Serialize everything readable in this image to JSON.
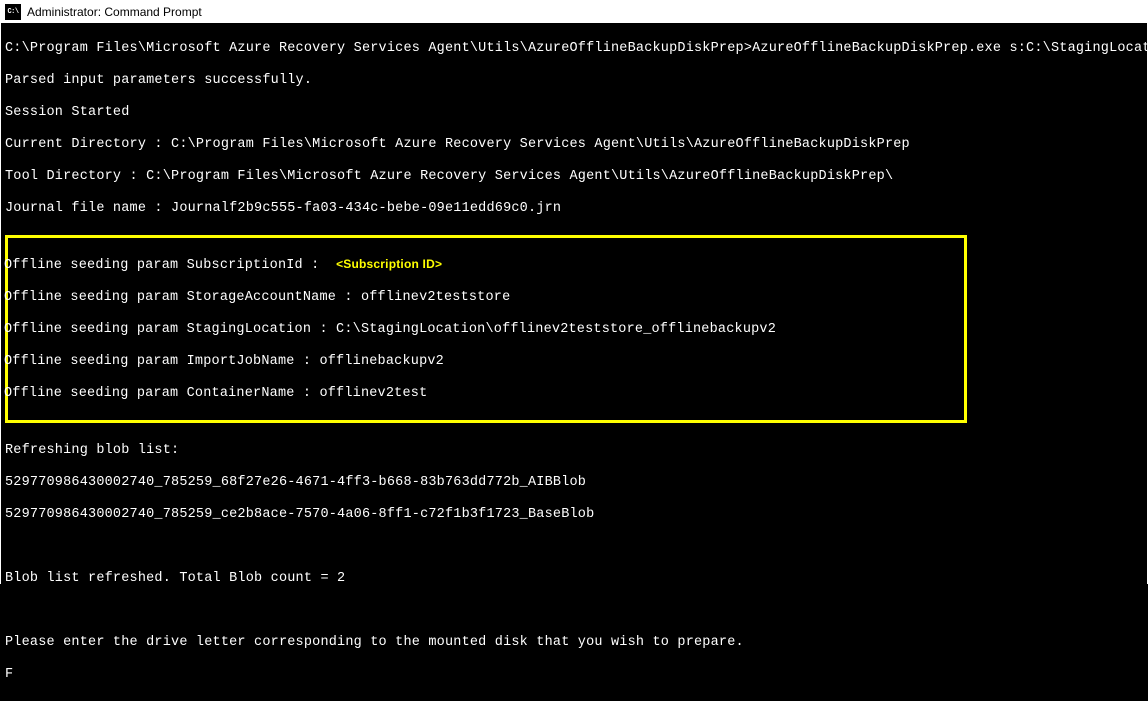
{
  "window": {
    "title": "Administrator: Command Prompt"
  },
  "terminal": {
    "command_line": "C:\\Program Files\\Microsoft Azure Recovery Services Agent\\Utils\\AzureOfflineBackupDiskPrep>AzureOfflineBackupDiskPrep.exe s:C:\\StagingLocation",
    "parsed_params": "Parsed input parameters successfully.",
    "session_started": "Session Started",
    "current_dir": "Current Directory : C:\\Program Files\\Microsoft Azure Recovery Services Agent\\Utils\\AzureOfflineBackupDiskPrep",
    "tool_dir": "Tool Directory : C:\\Program Files\\Microsoft Azure Recovery Services Agent\\Utils\\AzureOfflineBackupDiskPrep\\",
    "journal": "Journal file name : Journalf2b9c555-fa03-434c-bebe-09e11edd69c0.jrn",
    "offline_params": {
      "subscription_prefix": "Offline seeding param SubscriptionId : ",
      "subscription_value": "<Subscription ID>",
      "storage_account": "Offline seeding param StorageAccountName : offlinev2teststore",
      "staging_location": "Offline seeding param StagingLocation : C:\\StagingLocation\\offlinev2teststore_offlinebackupv2",
      "import_job": "Offline seeding param ImportJobName : offlinebackupv2",
      "container": "Offline seeding param ContainerName : offlinev2test"
    },
    "refreshing": "Refreshing blob list:",
    "blob1": "529770986430002740_785259_68f27e26-4671-4ff3-b668-83b763dd772b_AIBBlob",
    "blob2": "529770986430002740_785259_ce2b8ace-7570-4a06-8ff1-c72f1b3f1723_BaseBlob",
    "blob_refreshed": "Blob list refreshed. Total Blob count = 2",
    "prompt": "Please enter the drive letter corresponding to the mounted disk that you wish to prepare.",
    "input": "F"
  }
}
